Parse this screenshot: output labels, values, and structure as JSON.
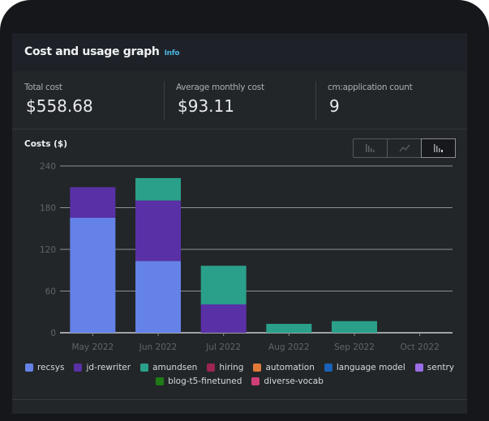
{
  "header": {
    "title": "Cost and usage graph",
    "info_label": "Info"
  },
  "summary": [
    {
      "label": "Total cost",
      "value": "$558.68"
    },
    {
      "label": "Average monthly cost",
      "value": "$93.11"
    },
    {
      "label": "cm:application count",
      "value": "9"
    }
  ],
  "chart_toolbar": {
    "buttons": [
      {
        "icon": "bar-chart-icon",
        "selected": false
      },
      {
        "icon": "line-chart-icon",
        "selected": false
      },
      {
        "icon": "stacked-bar-chart-icon",
        "selected": true
      }
    ]
  },
  "chart_data": {
    "type": "bar",
    "stacked": true,
    "title": "Costs ($)",
    "xlabel": "",
    "ylabel": "Costs ($)",
    "ylim": [
      0,
      240
    ],
    "yticks": [
      0,
      60,
      120,
      180,
      240
    ],
    "grid": true,
    "legend_position": "bottom",
    "categories": [
      "May 2022",
      "Jun 2022",
      "Jul 2022",
      "Aug 2022",
      "Sep 2022",
      "Oct 2022"
    ],
    "series": [
      {
        "name": "recsys",
        "color": "#6582e8",
        "values": [
          165.5,
          103.3,
          0,
          0,
          0,
          0
        ]
      },
      {
        "name": "jd-rewriter",
        "color": "#5a30a6",
        "values": [
          44,
          87,
          40.8,
          0,
          0,
          0
        ]
      },
      {
        "name": "amundsen",
        "color": "#2aa08a",
        "values": [
          0,
          32.3,
          55.6,
          12.8,
          16.7,
          0
        ]
      },
      {
        "name": "hiring",
        "color": "#9c2552",
        "values": [
          0,
          0,
          0,
          0,
          0,
          0
        ]
      },
      {
        "name": "automation",
        "color": "#e07a3a",
        "values": [
          0,
          0,
          0,
          0,
          0,
          0
        ]
      },
      {
        "name": "language model",
        "color": "#1a62b8",
        "values": [
          0,
          0,
          0,
          0,
          0,
          0
        ]
      },
      {
        "name": "sentry",
        "color": "#9a6ee6",
        "values": [
          0,
          0,
          0,
          0,
          0,
          0
        ]
      },
      {
        "name": "blog-t5-finetuned",
        "color": "#1f7a17",
        "values": [
          0,
          0,
          0,
          0,
          0,
          0
        ]
      },
      {
        "name": "diverse-vocab",
        "color": "#d23f78",
        "values": [
          0,
          0,
          0,
          0,
          0,
          0
        ]
      }
    ]
  }
}
